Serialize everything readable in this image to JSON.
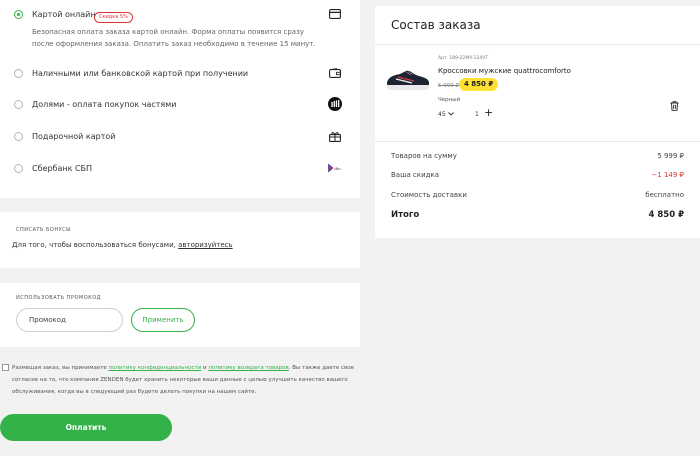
{
  "payment": {
    "options": [
      {
        "label": "Картой онлайн",
        "badge": "Скидка 5%",
        "selected": true,
        "icon": "card-icon"
      },
      {
        "label": "Наличными или банковской картой при получении",
        "selected": false,
        "icon": "wallet-icon"
      },
      {
        "label": "Долями - оплата покупок частями",
        "selected": false,
        "icon": "dolyami-icon"
      },
      {
        "label": "Подарочной картой",
        "selected": false,
        "icon": "gift-icon"
      },
      {
        "label": "Сбербанк СБП",
        "selected": false,
        "icon": "sbp-icon"
      }
    ],
    "description": "Безопасная оплата заказа картой онлайн. Форма оплаты появится сразу после оформления заказа. Оплатить заказ необходимо в течение 15 минут."
  },
  "bonus": {
    "label": "Списать бонусы",
    "text": "Для того, чтобы воспользоваться бонусами, ",
    "link": "авторизуйтесь"
  },
  "promo": {
    "label": "Использовать промокод",
    "placeholder": "Промокод",
    "apply_label": "Применить"
  },
  "consent": {
    "text_before": "Размещая заказ, вы принимаете ",
    "link1": "политику конфиденциальности",
    "text_mid": " и ",
    "link2": "политику возврата товаров",
    "text_after": ". Вы также даете свое согласие на то, что компания ZENDEN будет хранить некоторые ваши данные с целью улучшить качество вашего обслуживания, когда вы в следующий раз будете делать покупки на нашем сайте."
  },
  "pay_button": "Оплатить",
  "order": {
    "title": "Состав заказа",
    "item": {
      "article": "Арт. 189-22MV-124VT",
      "name": "Кроссовки мужские quattrocomforto",
      "old_price": "5 999 ₽",
      "new_price": "4 850 ₽",
      "color": "Черный",
      "size": "45",
      "quantity": "1"
    },
    "summary": [
      {
        "label": "Товаров на сумму",
        "value": "5 999 ₽"
      },
      {
        "label": "Ваша скидка",
        "value": "−1 149 ₽"
      },
      {
        "label": "Стоимость доставки",
        "value": "бесплатно"
      }
    ],
    "total": {
      "label": "Итого",
      "value": "4 850 ₽"
    }
  },
  "colors": {
    "accent": "#33b249",
    "discount": "#e03636",
    "price_badge": "#ffe033"
  }
}
